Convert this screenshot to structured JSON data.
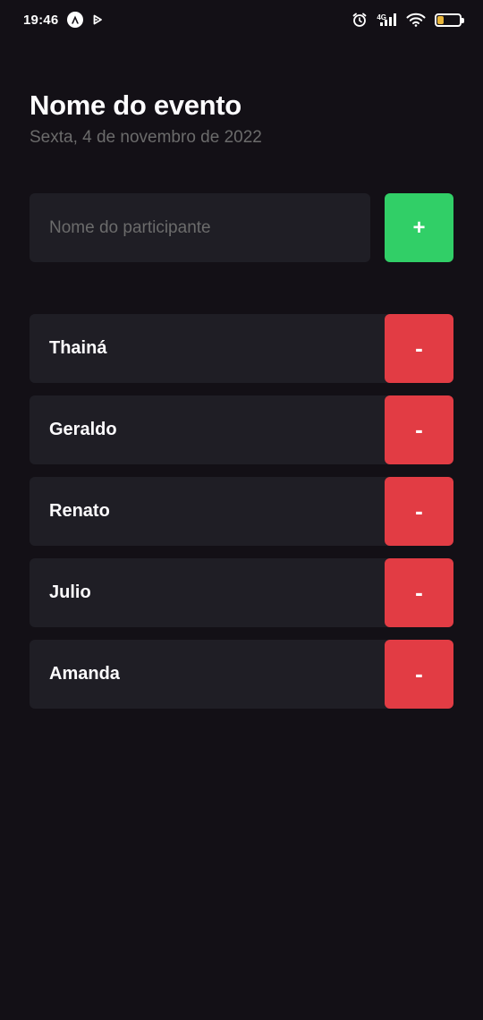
{
  "status_bar": {
    "time": "19:46",
    "network_label": "4G",
    "battery_level": "35",
    "battery_fraction": 0.35,
    "icons": [
      "a-circle-icon",
      "play-icon",
      "alarm-icon",
      "signal-icon",
      "wifi-icon",
      "battery-icon"
    ]
  },
  "header": {
    "title": "Nome do evento",
    "date": "Sexta, 4 de novembro de 2022"
  },
  "form": {
    "input_placeholder": "Nome do participante",
    "input_value": "",
    "add_button_label": "+"
  },
  "participants": [
    {
      "name": "Thainá",
      "remove_label": "-"
    },
    {
      "name": "Geraldo",
      "remove_label": "-"
    },
    {
      "name": "Renato",
      "remove_label": "-"
    },
    {
      "name": "Julio",
      "remove_label": "-"
    },
    {
      "name": "Amanda",
      "remove_label": "-"
    }
  ],
  "colors": {
    "background": "#131016",
    "card": "#1F1E25",
    "add": "#31CF67",
    "remove": "#E23C44",
    "muted_text": "#6B6B6B",
    "text": "#FDFCFE"
  }
}
